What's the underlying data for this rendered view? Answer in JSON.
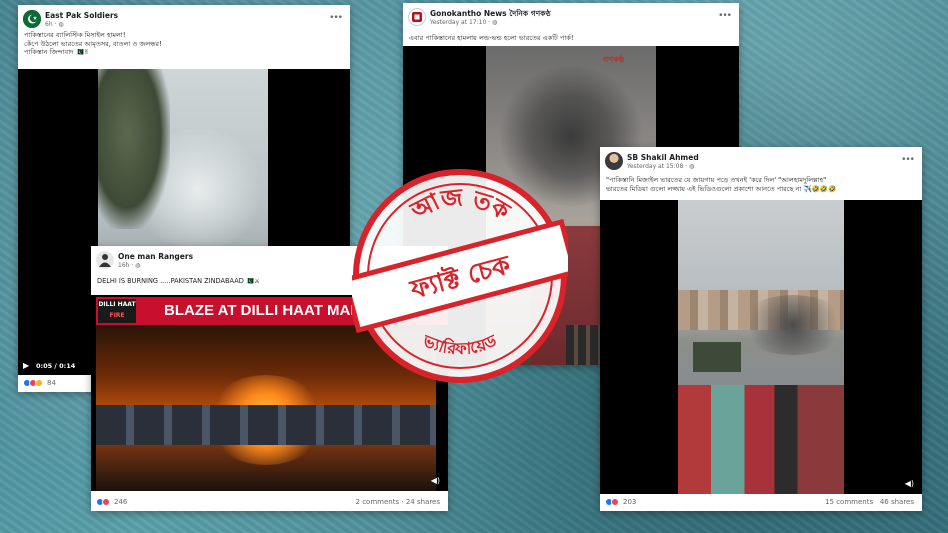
{
  "post1": {
    "name": "East Pak Soldiers",
    "time": "6h · ",
    "text_lines": [
      "পাকিস্তানের ব্যালিস্টিক মিসাইল হামলা!",
      "কেঁপে উঠলো ভারতের আমৃতসর, বাতলা ও জলন্ধর!",
      "পাকিস্তান জিন্দাবাদ 🇵🇰✌"
    ],
    "video_time": "0:05 / 0:14",
    "reaction_count": "84"
  },
  "post2": {
    "name": "Gonokantho News দৈনিক গণকণ্ঠ",
    "time": "Yesterday at 17:10 · ",
    "text": "এবার পাকিস্তানের হামলায় লন্ড-ভন্ড হলো ভারতের একটি পার্ক!",
    "watermark": "গণকণ্ঠ"
  },
  "post3": {
    "name": "SB Shakil Ahmed",
    "time": "Yesterday at 15:08 · ",
    "text_lines": [
      "\"পাকিস্তানি মিজাইল ভারতের যে জায়গায় পড়ে তখনই 'করে দিল' \"আলহামদুলিল্লাহ\"",
      "ভারতের মিডিয়া গুলো লজ্জায় এই ভিডিওগুলো প্রকাশো আনতে পারছে না ✈️🤣🤣🤣"
    ],
    "reaction_count": "203",
    "comments": "15 comments",
    "shares": "46 shares"
  },
  "post4": {
    "name": "One man Rangers",
    "time": "16h · ",
    "text": "DELHI IS BURNING .....PAKISTAN ZINDABAAD 🇵🇰⚔",
    "tag_line1": "DILLI HAAT",
    "tag_line2": "FIRE",
    "headline": "BLAZE AT DILLI HAAT MARK",
    "reaction_count": "246",
    "comments": "2 comments",
    "shares": "24 shares"
  },
  "stamp": {
    "top": "আজ তক",
    "middle": "ফ্যাক্ট চেক",
    "bottom": "ভ্যারিফায়েড"
  },
  "colors": {
    "stamp_red": "#d8232a",
    "fb_blue": "#1877f2",
    "react_red": "#f33e58",
    "react_yellow": "#f7b125"
  }
}
